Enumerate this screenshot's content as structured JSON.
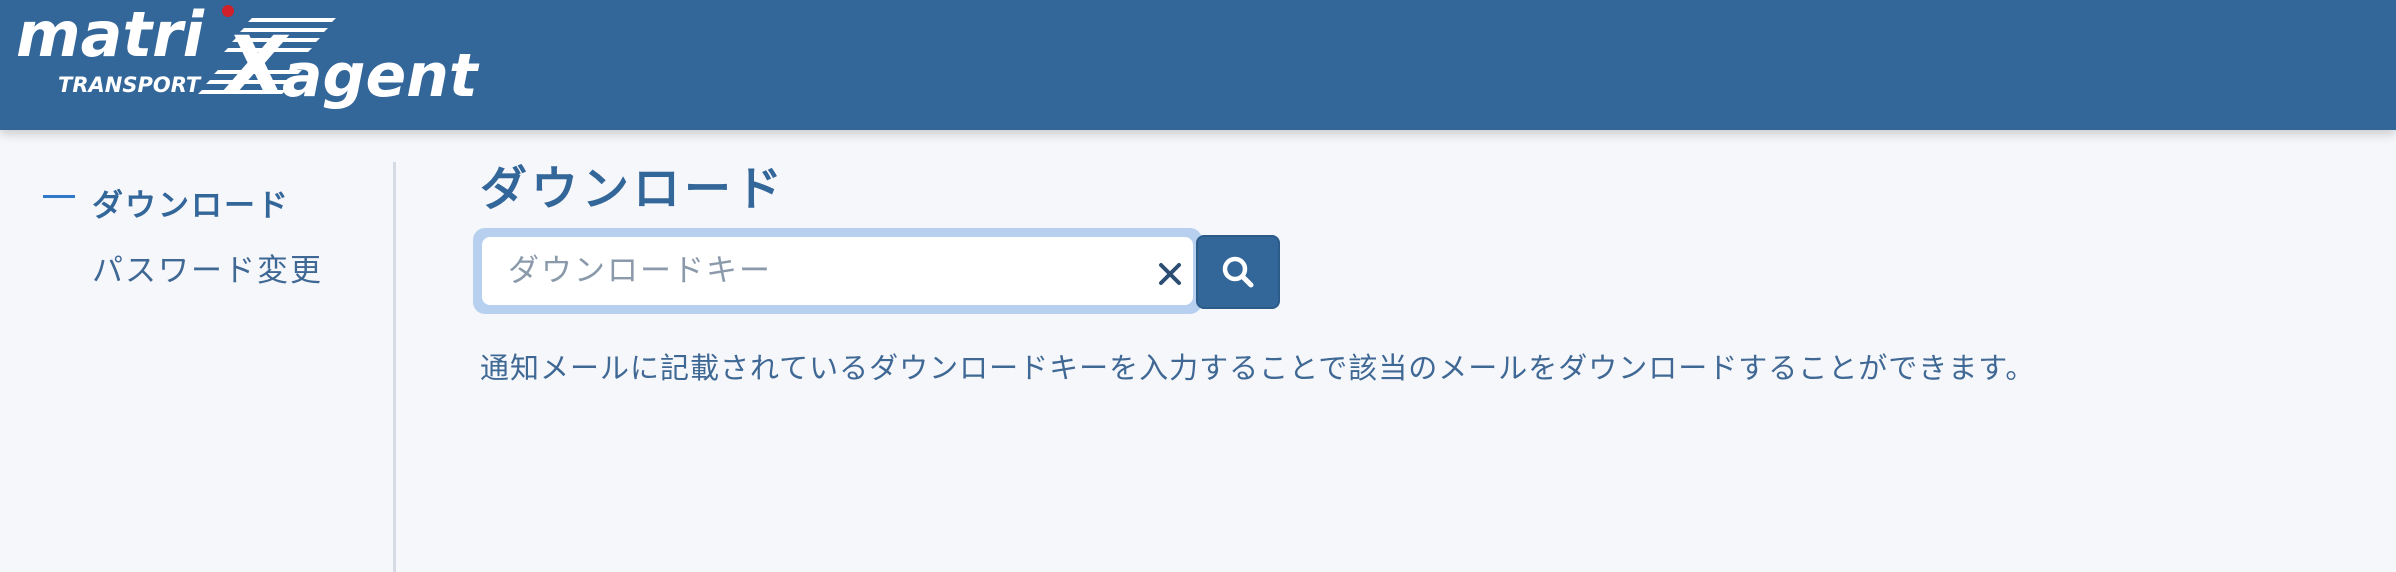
{
  "header": {
    "logo": {
      "main_text_left": "matri",
      "main_text_x": "X",
      "main_text_right": "agent",
      "sub_text": "TRANSPORT",
      "accent_dot_color": "#d0202a"
    }
  },
  "sidebar": {
    "items": [
      {
        "label": "ダウンロード",
        "active": true
      },
      {
        "label": "パスワード変更",
        "active": false
      }
    ]
  },
  "main": {
    "title": "ダウンロード",
    "search": {
      "placeholder": "ダウンロードキー",
      "value": "",
      "clear_icon": "close-icon",
      "search_icon": "search-icon"
    },
    "description": "通知メールに記載されているダウンロードキーを入力することで該当のメールをダウンロードすることができます。"
  },
  "colors": {
    "header_bg": "#336699",
    "page_bg": "#f6f7fb",
    "accent": "#336699",
    "active_marker": "#2f79c8",
    "focus_ring": "#b8d0f0"
  }
}
